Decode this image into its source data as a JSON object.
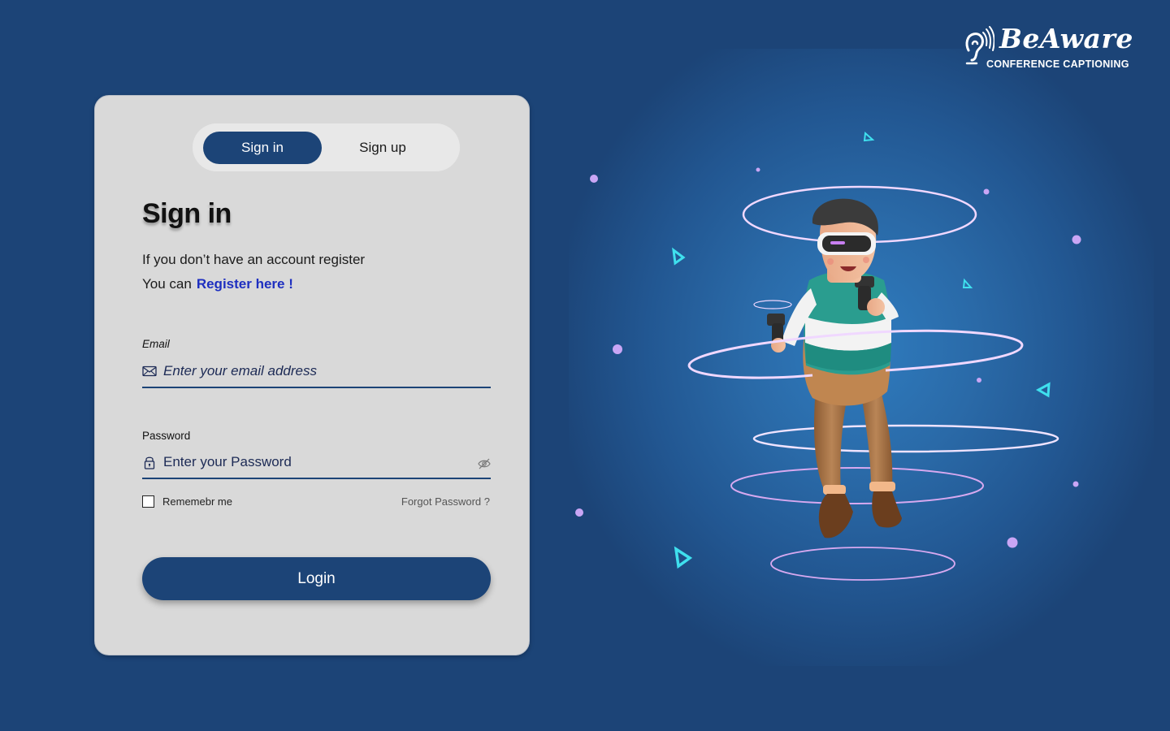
{
  "brand": {
    "name": "BeAware",
    "tagline": "CONFERENCE CAPTIONING"
  },
  "tabs": [
    {
      "label": "Sign in",
      "active": true
    },
    {
      "label": "Sign up",
      "active": false
    }
  ],
  "form": {
    "title": "Sign in",
    "subtitle_line1": "If you don’t have an account register",
    "subtitle_line2_prefix": "You can",
    "register_link": "Register here !",
    "email": {
      "label": "Email",
      "placeholder": "Enter your email address",
      "value": ""
    },
    "password": {
      "label": "Password",
      "placeholder": "Enter your Password",
      "value": ""
    },
    "remember_label": "Rememebr me",
    "remember_checked": false,
    "forgot_label": "Forgot Password ?",
    "login_label": "Login"
  },
  "illustration": {
    "subject": "3d-character-with-vr-headset"
  },
  "colors": {
    "background": "#1c4477",
    "primary": "#1c4477",
    "card": "#d9d9d9",
    "link": "#1e2fc0",
    "accent_cyan": "#3fe0ee",
    "accent_purple": "#c9a6f5"
  }
}
